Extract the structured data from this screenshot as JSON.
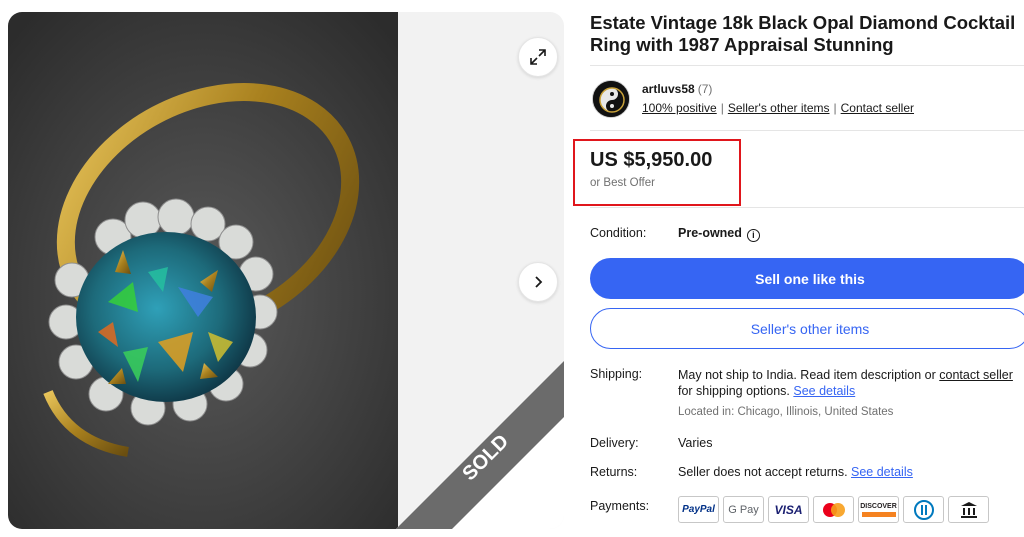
{
  "listing": {
    "title": "Estate Vintage 18k Black Opal Diamond Cocktail Ring with 1987 Appraisal Stunning",
    "sold_label": "SOLD"
  },
  "seller": {
    "name": "artluvs58",
    "feedback_count": "(7)",
    "positive": "100% positive",
    "other_items": "Seller's other items",
    "contact": "Contact seller"
  },
  "price": {
    "amount": "US $5,950.00",
    "best_offer": "or Best Offer"
  },
  "condition": {
    "label": "Condition:",
    "value": "Pre-owned",
    "info_icon": "info-icon"
  },
  "buttons": {
    "sell_one": "Sell one like this",
    "other_items": "Seller's other items"
  },
  "shipping": {
    "label": "Shipping:",
    "text_before": "May not ship to India. Read item description or ",
    "contact_link": "contact seller",
    "text_after": " for shipping options. ",
    "see_details": "See details",
    "located": "Located in: Chicago, Illinois, United States"
  },
  "delivery": {
    "label": "Delivery:",
    "value": "Varies"
  },
  "returns": {
    "label": "Returns:",
    "value": "Seller does not accept returns. ",
    "see_details": "See details"
  },
  "payments": {
    "label": "Payments:",
    "methods": [
      "PayPal",
      "G Pay",
      "VISA",
      "Mastercard",
      "DISCOVER",
      "Diners Club",
      "Bank"
    ]
  },
  "colors": {
    "accent": "#3665f3",
    "highlight_box": "#e0161c",
    "sold_band": "#6b6b6b"
  }
}
